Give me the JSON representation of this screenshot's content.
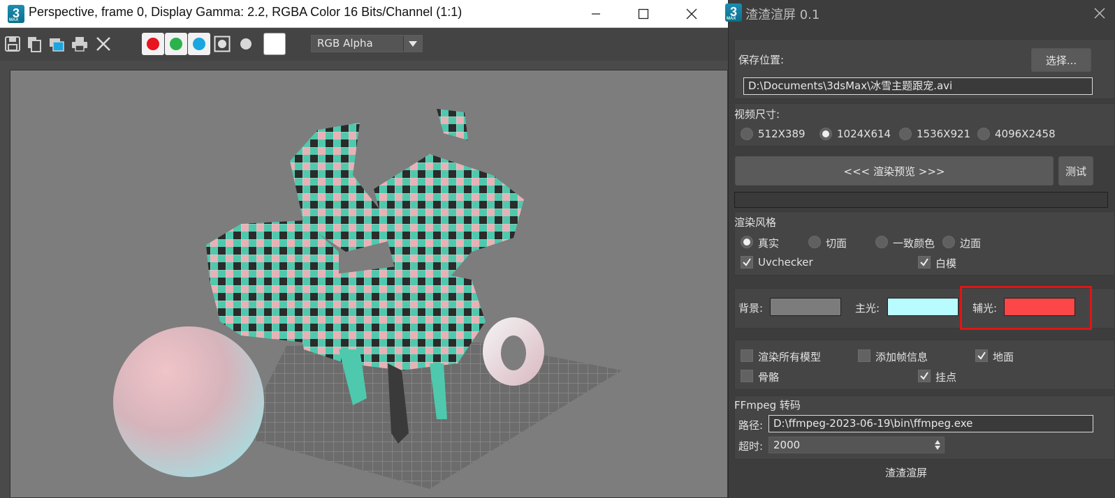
{
  "left_window": {
    "title": "Perspective, frame 0, Display Gamma: 2.2, RGBA Color 16 Bits/Channel (1:1)",
    "logo_text": "3",
    "toolbar": {
      "icons": [
        "save-icon",
        "copy-icon",
        "clone-window-icon",
        "print-icon",
        "clear-icon"
      ],
      "channels": [
        {
          "name": "red-channel",
          "color": "#e8141e"
        },
        {
          "name": "green-channel",
          "color": "#2bb24c"
        },
        {
          "name": "blue-channel",
          "color": "#1aa6e0"
        }
      ],
      "channel_select": "RGB Alpha"
    }
  },
  "right_window": {
    "title": "渣渣渲屏 0.1",
    "logo_text": "3",
    "save": {
      "label": "保存位置:",
      "button": "选择...",
      "path": "D:\\Documents\\3dsMax\\冰雪主题跟宠.avi"
    },
    "video_size": {
      "label": "视频尺寸:",
      "options": [
        "512X389",
        "1024X614",
        "1536X921",
        "4096X2458"
      ],
      "selected": "1024X614"
    },
    "preview_button": "<<<  渲染预览  >>>",
    "test_button": "测试",
    "render_style": {
      "label": "渲染风格",
      "options": [
        "真实",
        "切面",
        "一致颜色",
        "边面"
      ],
      "selected": "真实",
      "checks": [
        {
          "label": "Uvchecker",
          "checked": true
        },
        {
          "label": "白模",
          "checked": true
        }
      ]
    },
    "lights": {
      "background_label": "背景:",
      "background_color": "#7c7c7c",
      "key_label": "主光:",
      "key_color": "#b8fcff",
      "fill_label": "辅光:",
      "fill_color": "#fb4747"
    },
    "options": [
      {
        "label": "渲染所有模型",
        "checked": false
      },
      {
        "label": "添加帧信息",
        "checked": false
      },
      {
        "label": "地面",
        "checked": true
      },
      {
        "label": "骨骼",
        "checked": false
      },
      {
        "label": "挂点",
        "checked": true
      }
    ],
    "ffmpeg": {
      "label": "FFmpeg 转码",
      "path_label": "路径:",
      "path": "D:\\ffmpeg-2023-06-19\\bin\\ffmpeg.exe",
      "timeout_label": "超时:",
      "timeout": "2000"
    },
    "footer": "渣渣渲屏"
  }
}
